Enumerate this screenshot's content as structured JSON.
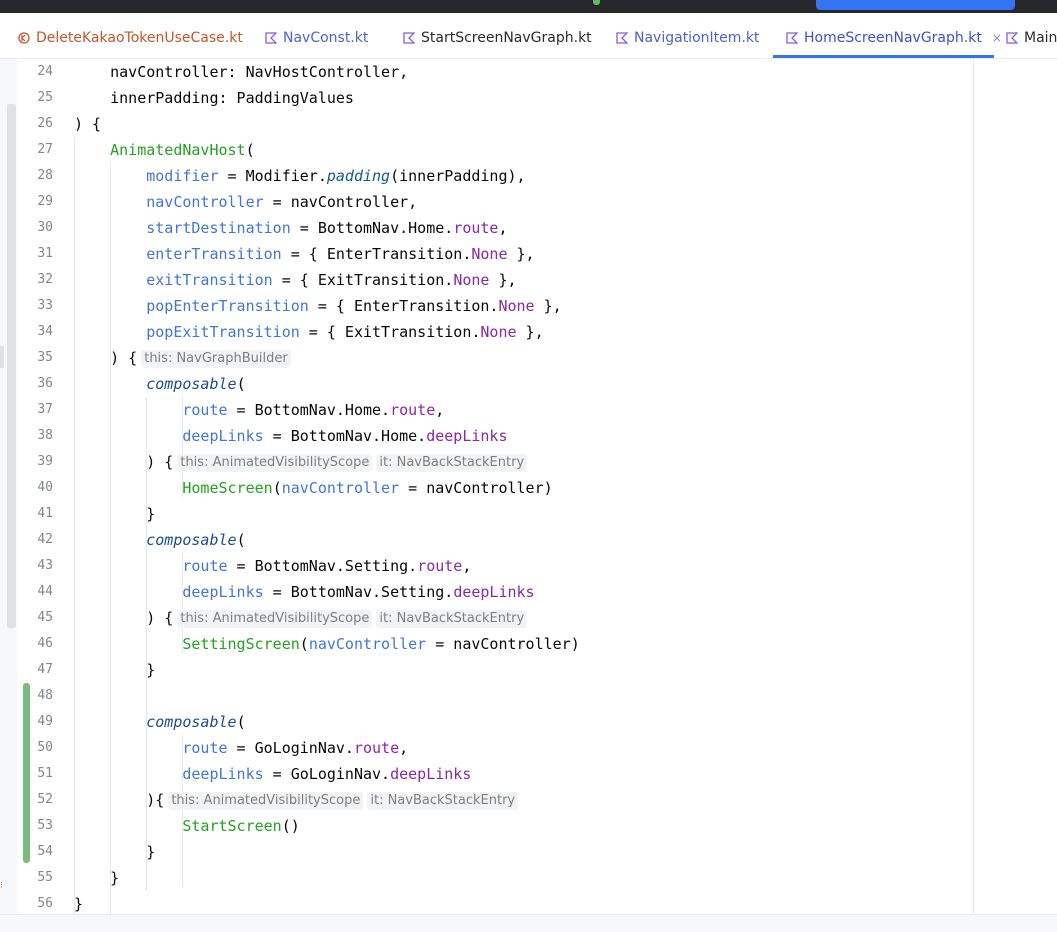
{
  "window": {
    "topbar_color": "#27282c",
    "accent": "#3574f0"
  },
  "tabs": [
    {
      "label": "DeleteKakaoTokenUseCase.kt",
      "icon": "kotlin-class-warning-icon",
      "active": false
    },
    {
      "label": "NavConst.kt",
      "icon": "kotlin-file-icon",
      "active": false
    },
    {
      "label": "StartScreenNavGraph.kt",
      "icon": "kotlin-file-icon",
      "active": false
    },
    {
      "label": "NavigationItem.kt",
      "icon": "kotlin-file-icon",
      "active": false
    },
    {
      "label": "HomeScreenNavGraph.kt",
      "icon": "kotlin-file-icon",
      "active": true,
      "close": "×"
    },
    {
      "label": "MainS",
      "icon": "kotlin-file-icon",
      "active": false
    }
  ],
  "line_numbers": [
    "24",
    "25",
    "26",
    "27",
    "28",
    "29",
    "30",
    "31",
    "32",
    "33",
    "34",
    "35",
    "36",
    "37",
    "38",
    "39",
    "40",
    "41",
    "42",
    "43",
    "44",
    "45",
    "46",
    "47",
    "48",
    "49",
    "50",
    "51",
    "52",
    "53",
    "54",
    "55",
    "56"
  ],
  "code": {
    "l24": "    navController: NavHostController,",
    "l25": "    innerPadding: PaddingValues",
    "l26": ") {",
    "l27": {
      "fn": "AnimatedNavHost",
      "rest": "("
    },
    "l28": {
      "a": "modifier",
      "b": " = Modifier.",
      "c": "padding",
      "d": "(innerPadding),"
    },
    "l29": {
      "a": "navController",
      "b": " = navController,"
    },
    "l30": {
      "a": "startDestination",
      "b": " = BottomNav.Home.",
      "c": "route",
      "d": ","
    },
    "l31": {
      "a": "enterTransition",
      "b": " = { EnterTransition.",
      "c": "None",
      "d": " },"
    },
    "l32": {
      "a": "exitTransition",
      "b": " = { ExitTransition.",
      "c": "None",
      "d": " },"
    },
    "l33": {
      "a": "popEnterTransition",
      "b": " = { EnterTransition.",
      "c": "None",
      "d": " },"
    },
    "l34": {
      "a": "popExitTransition",
      "b": " = { ExitTransition.",
      "c": "None",
      "d": " },"
    },
    "l35": {
      "a": ") {",
      "hint": "this: NavGraphBuilder"
    },
    "l36": {
      "a": "composable",
      "b": "("
    },
    "l37": {
      "a": "route",
      "b": " = BottomNav.Home.",
      "c": "route",
      "d": ","
    },
    "l38": {
      "a": "deepLinks",
      "b": " = BottomNav.Home.",
      "c": "deepLinks"
    },
    "l39": {
      "a": ") {",
      "hint1": "this: AnimatedVisibilityScope",
      "hint2": "it: NavBackStackEntry"
    },
    "l40": {
      "a": "HomeScreen",
      "b": "(",
      "c": "navController",
      "d": " = navController)"
    },
    "l41": "}",
    "l42": {
      "a": "composable",
      "b": "("
    },
    "l43": {
      "a": "route",
      "b": " = BottomNav.Setting.",
      "c": "route",
      "d": ","
    },
    "l44": {
      "a": "deepLinks",
      "b": " = BottomNav.Setting.",
      "c": "deepLinks"
    },
    "l45": {
      "a": ") {",
      "hint1": "this: AnimatedVisibilityScope",
      "hint2": "it: NavBackStackEntry"
    },
    "l46": {
      "a": "SettingScreen",
      "b": "(",
      "c": "navController",
      "d": " = navController)"
    },
    "l47": "}",
    "l49": {
      "a": "composable",
      "b": "("
    },
    "l50": {
      "a": "route",
      "b": " = GoLoginNav.",
      "c": "route",
      "d": ","
    },
    "l51": {
      "a": "deepLinks",
      "b": " = GoLoginNav.",
      "c": "deepLinks"
    },
    "l52": {
      "a": "){",
      "hint1": "this: AnimatedVisibilityScope",
      "hint2": "it: NavBackStackEntry"
    },
    "l53": {
      "a": "StartScreen",
      "b": "()"
    },
    "l54": "}",
    "l55": "}",
    "l56": "}"
  }
}
